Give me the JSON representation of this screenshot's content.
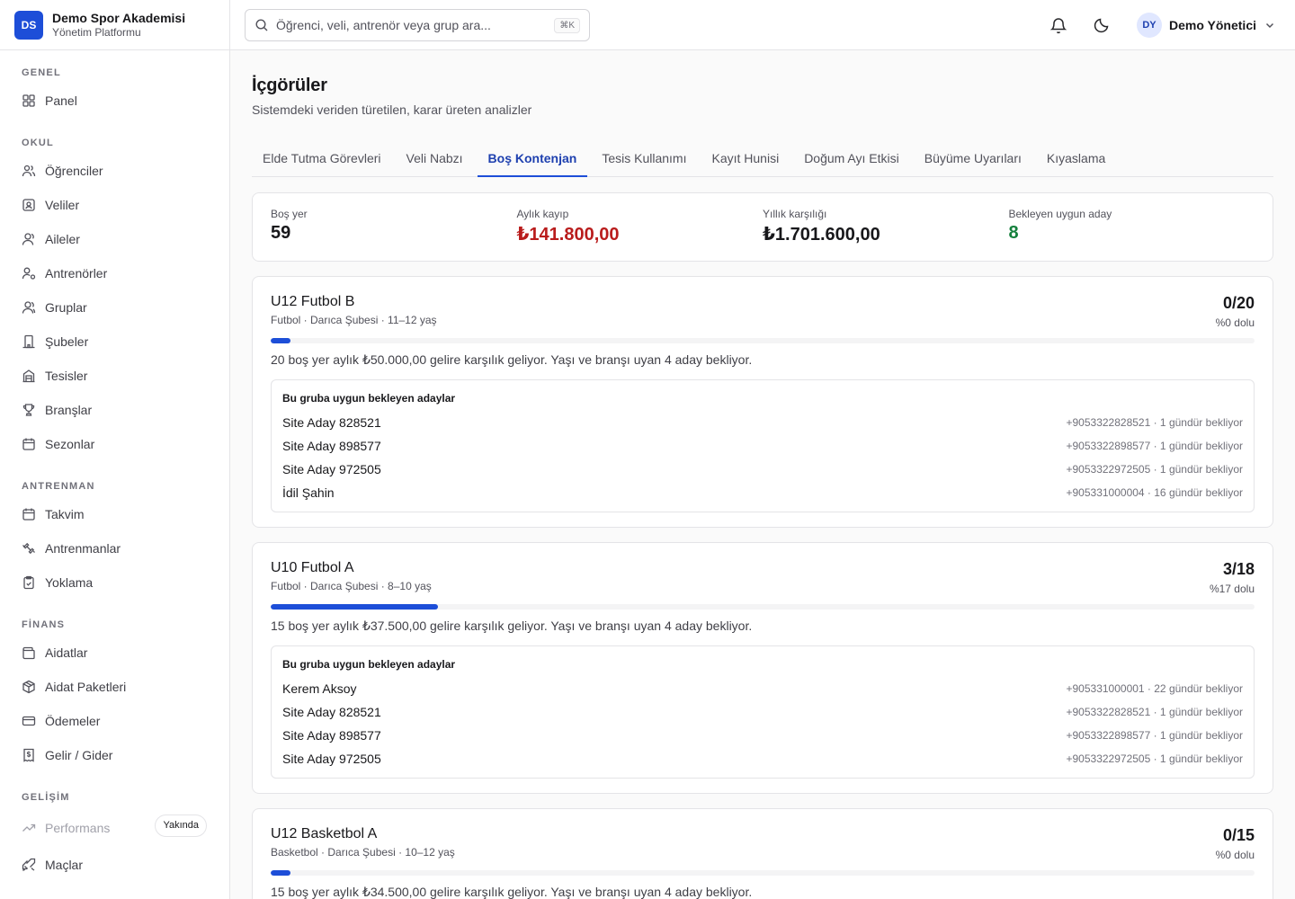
{
  "brand": {
    "initials": "DS",
    "name": "Demo Spor Akademisi",
    "subtitle": "Yönetim Platformu"
  },
  "sidebar": {
    "sections": [
      {
        "label": "GENEL",
        "items": [
          {
            "label": "Panel",
            "icon": "dashboard-icon"
          }
        ]
      },
      {
        "label": "OKUL",
        "items": [
          {
            "label": "Öğrenciler",
            "icon": "users-icon"
          },
          {
            "label": "Veliler",
            "icon": "contact-icon"
          },
          {
            "label": "Aileler",
            "icon": "family-icon"
          },
          {
            "label": "Antrenörler",
            "icon": "coach-icon"
          },
          {
            "label": "Gruplar",
            "icon": "group-icon"
          },
          {
            "label": "Şubeler",
            "icon": "building-icon"
          },
          {
            "label": "Tesisler",
            "icon": "facility-icon"
          },
          {
            "label": "Branşlar",
            "icon": "trophy-icon"
          },
          {
            "label": "Sezonlar",
            "icon": "calendar-range-icon"
          }
        ]
      },
      {
        "label": "ANTRENMAN",
        "items": [
          {
            "label": "Takvim",
            "icon": "calendar-icon"
          },
          {
            "label": "Antrenmanlar",
            "icon": "dumbbell-icon"
          },
          {
            "label": "Yoklama",
            "icon": "clipboard-check-icon"
          }
        ]
      },
      {
        "label": "FİNANS",
        "items": [
          {
            "label": "Aidatlar",
            "icon": "wallet-icon"
          },
          {
            "label": "Aidat Paketleri",
            "icon": "package-icon"
          },
          {
            "label": "Ödemeler",
            "icon": "credit-card-icon"
          },
          {
            "label": "Gelir / Gider",
            "icon": "receipt-icon"
          }
        ]
      },
      {
        "label": "GELİŞİM",
        "items": [
          {
            "label": "Performans",
            "icon": "trending-up-icon",
            "badge": "Yakında",
            "disabled": true
          },
          {
            "label": "Maçlar",
            "icon": "swords-icon"
          }
        ]
      }
    ]
  },
  "topbar": {
    "search_placeholder": "Öğrenci, veli, antrenör veya grup ara...",
    "search_shortcut": "⌘K",
    "notifications_icon": "bell-icon",
    "theme_icon": "moon-icon",
    "user": {
      "initials": "DY",
      "name": "Demo Yönetici"
    }
  },
  "page": {
    "title": "İçgörüler",
    "subtitle": "Sistemdeki veriden türetilen, karar üreten analizler",
    "tabs": [
      "Elde Tutma Görevleri",
      "Veli Nabzı",
      "Boş Kontenjan",
      "Tesis Kullanımı",
      "Kayıt Hunisi",
      "Doğum Ayı Etkisi",
      "Büyüme Uyarıları",
      "Kıyaslama"
    ],
    "active_tab": "Boş Kontenjan"
  },
  "stats": [
    {
      "label": "Boş yer",
      "value": "59",
      "tone": "default"
    },
    {
      "label": "Aylık kayıp",
      "value": "₺141.800,00",
      "tone": "red"
    },
    {
      "label": "Yıllık karşılığı",
      "value": "₺1.701.600,00",
      "tone": "default"
    },
    {
      "label": "Bekleyen uygun aday",
      "value": "8",
      "tone": "green"
    }
  ],
  "colors": {
    "accent": "#1d4ed8",
    "loss": "#b91c1c",
    "positive": "#15803d"
  },
  "groups": [
    {
      "name": "U12 Futbol B",
      "meta": "Futbol · Darıca Şubesi · 11–12 yaş",
      "count": "0/20",
      "fill_text": "%0 dolu",
      "fill_percent": 0,
      "note": "20 boş yer aylık ₺50.000,00 gelire karşılık geliyor. Yaşı ve branşı uyan 4 aday bekliyor.",
      "candidates_title": "Bu gruba uygun bekleyen adaylar",
      "candidates": [
        {
          "name": "Site Aday 828521",
          "info": "+9053322828521 · 1 gündür bekliyor"
        },
        {
          "name": "Site Aday 898577",
          "info": "+9053322898577 · 1 gündür bekliyor"
        },
        {
          "name": "Site Aday 972505",
          "info": "+9053322972505 · 1 gündür bekliyor"
        },
        {
          "name": "İdil Şahin",
          "info": "+905331000004 · 16 gündür bekliyor"
        }
      ]
    },
    {
      "name": "U10 Futbol A",
      "meta": "Futbol · Darıca Şubesi · 8–10 yaş",
      "count": "3/18",
      "fill_text": "%17 dolu",
      "fill_percent": 17,
      "note": "15 boş yer aylık ₺37.500,00 gelire karşılık geliyor. Yaşı ve branşı uyan 4 aday bekliyor.",
      "candidates_title": "Bu gruba uygun bekleyen adaylar",
      "candidates": [
        {
          "name": "Kerem Aksoy",
          "info": "+905331000001 · 22 gündür bekliyor"
        },
        {
          "name": "Site Aday 828521",
          "info": "+9053322828521 · 1 gündür bekliyor"
        },
        {
          "name": "Site Aday 898577",
          "info": "+9053322898577 · 1 gündür bekliyor"
        },
        {
          "name": "Site Aday 972505",
          "info": "+9053322972505 · 1 gündür bekliyor"
        }
      ]
    },
    {
      "name": "U12 Basketbol A",
      "meta": "Basketbol · Darıca Şubesi · 10–12 yaş",
      "count": "0/15",
      "fill_text": "%0 dolu",
      "fill_percent": 0,
      "note": "15 boş yer aylık ₺34.500,00 gelire karşılık geliyor. Yaşı ve branşı uyan 4 aday bekliyor."
    }
  ]
}
